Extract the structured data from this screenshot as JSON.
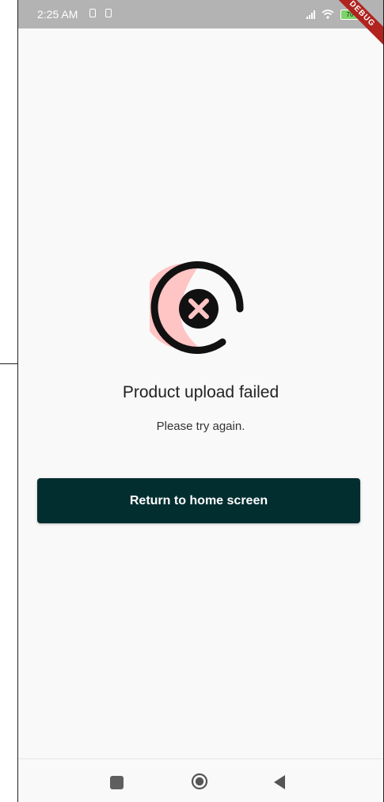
{
  "status_bar": {
    "time": "2:25 AM",
    "battery_level": "70",
    "debug_label": "DEBUG",
    "icons": [
      "sim-icon",
      "sim-icon",
      "signal-icon",
      "wifi-icon",
      "battery-icon"
    ]
  },
  "main": {
    "icon": "error-circle-x-icon",
    "title": "Product upload failed",
    "subtitle": "Please try again.",
    "button_label": "Return to home screen"
  },
  "navigation_bar": {
    "icons": [
      "recent-apps-icon",
      "home-icon",
      "back-icon"
    ]
  },
  "colors": {
    "button_background": "#032e30",
    "icon_fill": "#ffc4c4",
    "status_bar": "#b3b3b3",
    "debug_ribbon": "#b0231e"
  }
}
